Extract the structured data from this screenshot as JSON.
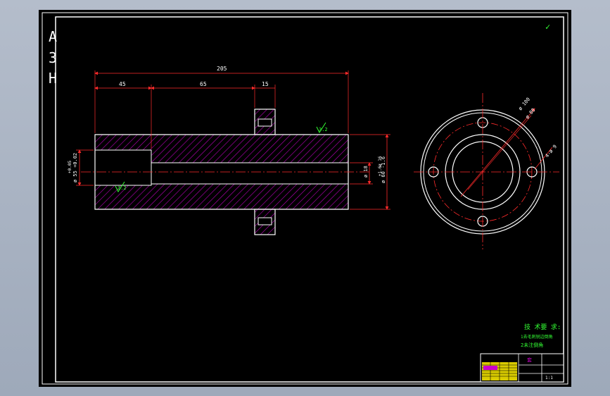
{
  "colors": {
    "background": "#000000",
    "frame": "#ffffff",
    "dimension": "#ff2b2b",
    "hatch": "#b000b0",
    "note": "#33ff33",
    "title_block_fill": "#ffee00",
    "title_block_cell": "#cc00cc"
  },
  "sheet": {
    "code_letters": [
      "A",
      "3",
      "H"
    ],
    "corner_mark": "✓"
  },
  "dimensions": {
    "total_length": "205",
    "left_segment": "45",
    "middle_segment": "65",
    "flange_width": "15",
    "bore_left_upper": "+0.05",
    "bore_left_lower": "ø 55 +0.02",
    "center_bore": "ø 18",
    "outer_diam_upper": "ø 16",
    "outer_diam_tol": "+1.6",
    "outer_diam_main": "ø 60 -1.6",
    "surface_roughness_top": "3.2",
    "surface_roughness_inner": "3.2",
    "flange_outer": "ø 100",
    "bolt_circle": "ø 80",
    "bolt_holes": "4-ø 9"
  },
  "notes": {
    "heading": "技 术要 求:",
    "line1": "1去毛刺锐边倒角",
    "line2": "2未注倒角"
  },
  "title_block": {
    "part_name": "套",
    "scale": "1:1"
  }
}
